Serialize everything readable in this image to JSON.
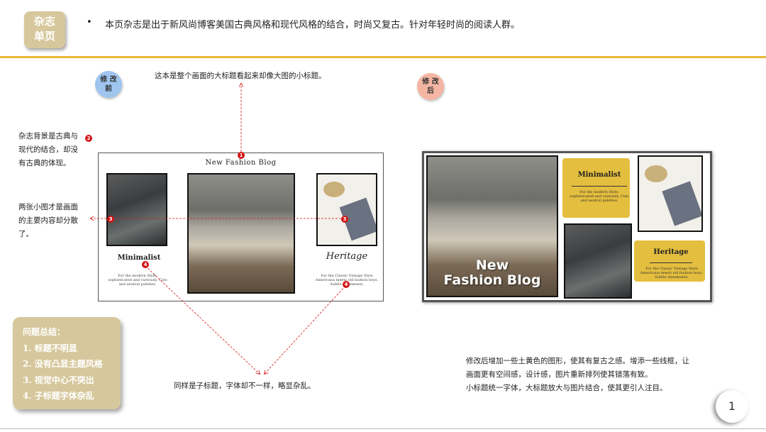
{
  "header": {
    "tag_line1": "杂志",
    "tag_line2": "单页",
    "bullet": "•",
    "bullet_text": "本页杂志是出于新风尚博客美国古典风格和现代风格的结合，时尚又复古。针对年轻时尚的阅读人群。",
    "accent_color": "#e8b93a"
  },
  "labels": {
    "before_line1": "修 改",
    "before_line2": "前",
    "after_line1": "修 改",
    "after_line2": "后"
  },
  "annotations": {
    "title_note": "这本是整个画面的大标题看起来却像大图的小标题。",
    "bg_note": [
      "杂志背景是古典与",
      "现代的结合，却没",
      "有古典的体现。"
    ],
    "images_note": [
      "两张小图才是画面",
      "的主要内容却分散",
      "了。"
    ],
    "subtitle_note": "同样是子标题，字体却不一样，略显杂乱。",
    "badge1": "1",
    "badge2": "2",
    "badge3": "3",
    "badge4": "4"
  },
  "before_layout": {
    "blog_title": "New Fashion Blog",
    "left_heading": "Minimalist",
    "left_body": "For the modern Style, sophisticated and variously. Cuts and neutral palettes.",
    "right_heading": "Heritage",
    "right_body": "For the Classic Vintage Style Americana meets old fashion boys. Subtle statements."
  },
  "after_layout": {
    "blog_title_line1": "New",
    "blog_title_line2": "Fashion Blog",
    "minimalist_heading": "Minimalist",
    "minimalist_body": "For the modern Style, sophisticated and variously. Cuts and neutral palettes.",
    "heritage_heading": "Heritage",
    "heritage_body": "For the Classic Vintage Style Americana meets old fashion boys. Subtle statements.",
    "brush_color": "#e4be3e"
  },
  "summary": {
    "title": "问题总结：",
    "items": [
      "1. 标题不明显",
      "2. 没有凸显主题风格",
      "3. 视觉中心不突出",
      "4. 子标题字体杂乱"
    ]
  },
  "after_notes": [
    "修改后增加一些土黄色的图形，使其有复古之感。增添一些线框，让",
    "画面更有空间感，设计感，图片重新排列使其错落有致。",
    "小标题统一字体，大标题放大与图片结合，使其更引人注目。"
  ],
  "page_number": "1"
}
